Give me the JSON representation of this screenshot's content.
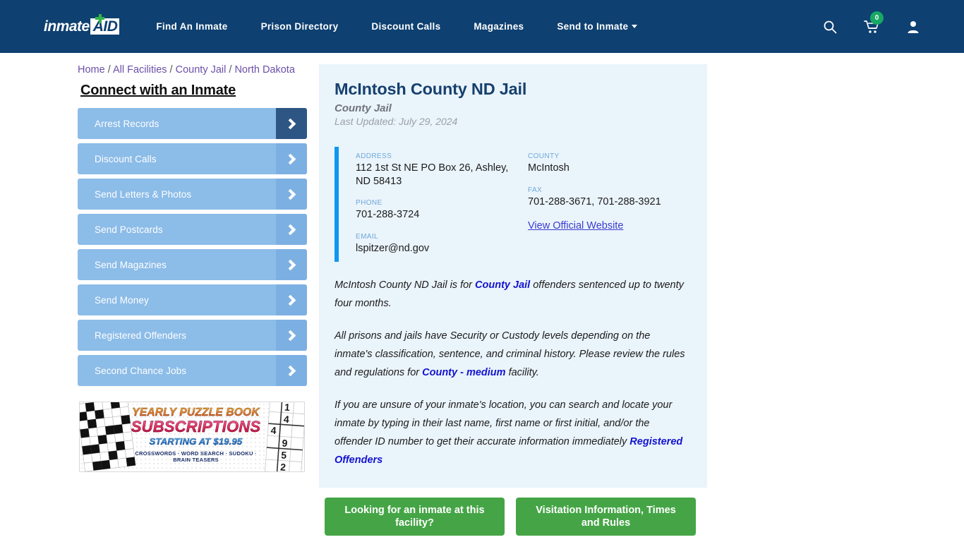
{
  "header": {
    "logo": {
      "primary": "inmate",
      "secondary": "AID"
    },
    "nav_items": [
      {
        "label": "Find An Inmate",
        "has_dropdown": false
      },
      {
        "label": "Prison Directory",
        "has_dropdown": false
      },
      {
        "label": "Discount Calls",
        "has_dropdown": false
      },
      {
        "label": "Magazines",
        "has_dropdown": false
      },
      {
        "label": "Send to Inmate",
        "has_dropdown": true
      }
    ],
    "icons": [
      {
        "name": "search-icon"
      },
      {
        "name": "cart-icon",
        "badge": "0"
      },
      {
        "name": "account-icon"
      }
    ],
    "background_color": "#0e4071",
    "badge_color": "#16a864"
  },
  "breadcrumb": {
    "items": [
      "Home",
      "All Facilities",
      "County Jail",
      "North Dakota"
    ],
    "separator": "/"
  },
  "sidebar": {
    "title": "Connect with an Inmate",
    "items": [
      {
        "label": "Arrest Records",
        "active": true
      },
      {
        "label": "Discount Calls",
        "active": false
      },
      {
        "label": "Send Letters & Photos",
        "active": false
      },
      {
        "label": "Send Postcards",
        "active": false
      },
      {
        "label": "Send Magazines",
        "active": false
      },
      {
        "label": "Send Money",
        "active": false
      },
      {
        "label": "Registered Offenders",
        "active": false
      },
      {
        "label": "Second Chance Jobs",
        "active": false
      }
    ],
    "ad": {
      "line1": "YEARLY PUZZLE BOOK",
      "line2": "SUBSCRIPTIONS",
      "line3": "STARTING AT $19.95",
      "line4": "CROSSWORDS · WORD SEARCH · SUDOKU · BRAIN TEASERS",
      "sudoku_digits": [
        "1",
        "4",
        "4",
        "9",
        "5",
        "2"
      ]
    }
  },
  "facility": {
    "name": "McIntosh County ND Jail",
    "type": "County Jail",
    "last_updated": "Last Updated: July 29, 2024",
    "accent_color": "#0f97ef",
    "contact": {
      "left": [
        {
          "label": "ADDRESS",
          "value": "112 1st St NE PO Box 26, Ashley, ND 58413"
        },
        {
          "label": "PHONE",
          "value": "701-288-3724"
        },
        {
          "label": "EMAIL",
          "value": "lspitzer@nd.gov"
        }
      ],
      "right": [
        {
          "label": "COUNTY",
          "value": "McIntosh"
        },
        {
          "label": "FAX",
          "value": "701-288-3671, 701-288-3921"
        }
      ],
      "website_link": "View Official Website"
    },
    "paragraphs": {
      "p1_a": "McIntosh County ND Jail is for ",
      "p1_link": "County Jail",
      "p1_b": " offenders sentenced up to twenty four months.",
      "p2_a": "All prisons and jails have Security or Custody levels depending on the inmate's classification, sentence, and criminal history. Please review the rules and regulations for ",
      "p2_link": "County - medium",
      "p2_b": " facility.",
      "p3_a": "If you are unsure of your inmate's location, you can search and locate your inmate by typing in their last name, first name or first initial, and/or the offender ID number to get their accurate information immediately ",
      "p3_link": "Registered Offenders"
    }
  },
  "cta": {
    "buttons": [
      {
        "label": "Looking for an inmate at this facility?"
      },
      {
        "label": "Visitation Information, Times and Rules"
      }
    ],
    "color": "#45a546"
  }
}
